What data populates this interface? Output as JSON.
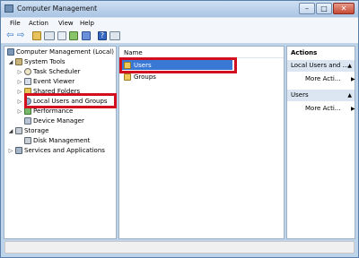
{
  "window": {
    "title": "Computer Management"
  },
  "menu": {
    "file": "File",
    "action": "Action",
    "view": "View",
    "help": "Help"
  },
  "tree": {
    "root": "Computer Management (Local)",
    "system_tools": "System Tools",
    "task_scheduler": "Task Scheduler",
    "event_viewer": "Event Viewer",
    "shared_folders": "Shared Folders",
    "local_users_groups": "Local Users and Groups",
    "performance": "Performance",
    "device_manager": "Device Manager",
    "storage": "Storage",
    "disk_management": "Disk Management",
    "services_apps": "Services and Applications"
  },
  "list": {
    "header_name": "Name",
    "rows": [
      "Users",
      "Groups"
    ]
  },
  "actions": {
    "title": "Actions",
    "section1": "Local Users and ...",
    "more1": "More Acti...",
    "section2": "Users",
    "more2": "More Acti..."
  },
  "colors": {
    "highlight": "#d10f1f",
    "selection": "#3a78d6"
  }
}
